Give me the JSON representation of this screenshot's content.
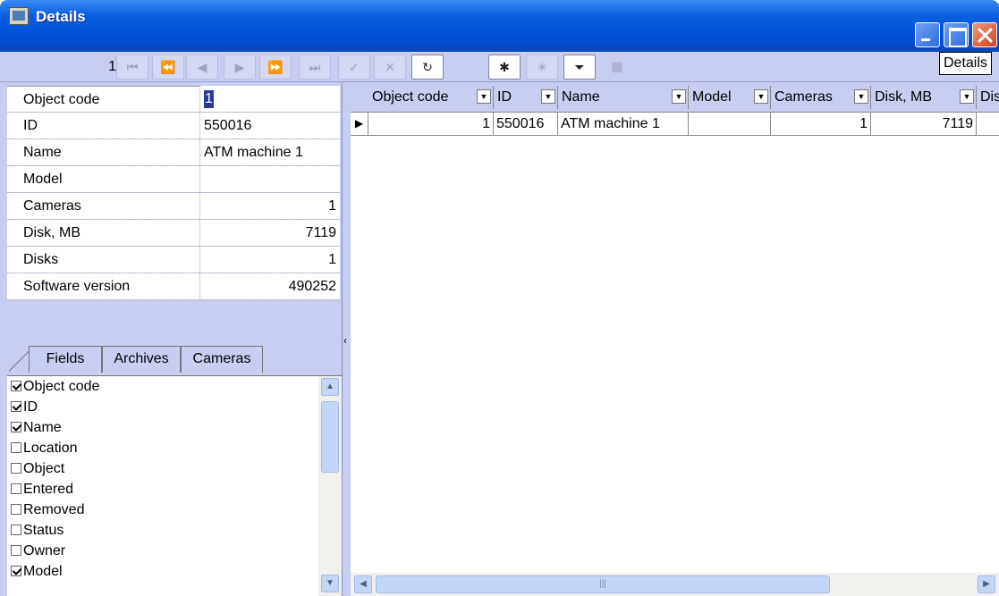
{
  "window": {
    "title": "Details",
    "tooltip": "Details"
  },
  "navigator": {
    "record_number": "1",
    "buttons": [
      {
        "name": "first-record-button",
        "icon": "⏮"
      },
      {
        "name": "prior-page-button",
        "icon": "⏪"
      },
      {
        "name": "prior-record-button",
        "icon": "◀"
      },
      {
        "name": "next-record-button",
        "icon": "▶"
      },
      {
        "name": "next-page-button",
        "icon": "⏩"
      },
      {
        "name": "last-record-button",
        "icon": "⏭"
      },
      {
        "name": "post-button",
        "icon": "✓"
      },
      {
        "name": "cancel-button",
        "icon": "✕"
      },
      {
        "name": "refresh-button",
        "icon": "↻"
      },
      {
        "name": "new-record-button",
        "icon": "✱"
      },
      {
        "name": "clear-button",
        "icon": "✳"
      },
      {
        "name": "filter-button",
        "icon": "⏷"
      },
      {
        "name": "grid-button",
        "icon": "▦"
      }
    ]
  },
  "properties": [
    {
      "name": "Object code",
      "value": "1",
      "align": "left",
      "selected": true
    },
    {
      "name": "ID",
      "value": "550016",
      "align": "left"
    },
    {
      "name": "Name",
      "value": "ATM machine 1",
      "align": "left"
    },
    {
      "name": "Model",
      "value": "",
      "align": "left"
    },
    {
      "name": "Cameras",
      "value": "1",
      "align": "right"
    },
    {
      "name": "Disk, MB",
      "value": "7119",
      "align": "right"
    },
    {
      "name": "Disks",
      "value": "1",
      "align": "right"
    },
    {
      "name": "Software version",
      "value": "490252",
      "align": "right"
    }
  ],
  "tabs": [
    "Fields",
    "Archives",
    "Cameras"
  ],
  "fields": [
    {
      "label": "Object code",
      "checked": true
    },
    {
      "label": "ID",
      "checked": true
    },
    {
      "label": "Name",
      "checked": true
    },
    {
      "label": "Location",
      "checked": false
    },
    {
      "label": "Object",
      "checked": false
    },
    {
      "label": "Entered",
      "checked": false
    },
    {
      "label": "Removed",
      "checked": false
    },
    {
      "label": "Status",
      "checked": false
    },
    {
      "label": "Owner",
      "checked": false
    },
    {
      "label": "Model",
      "checked": true
    }
  ],
  "grid": {
    "columns": [
      "Object code",
      "ID",
      "Name",
      "Model",
      "Cameras",
      "Disk, MB",
      "Dis"
    ],
    "rows": [
      {
        "object_code": "1",
        "id": "550016",
        "name": "ATM machine 1",
        "model": "",
        "cameras": "1",
        "disk_mb": "7119",
        "disks": ""
      }
    ]
  },
  "colors": {
    "panel": "#c8cef0",
    "title_bar": "#0a5fe0",
    "selection": "#2a3a9a"
  }
}
